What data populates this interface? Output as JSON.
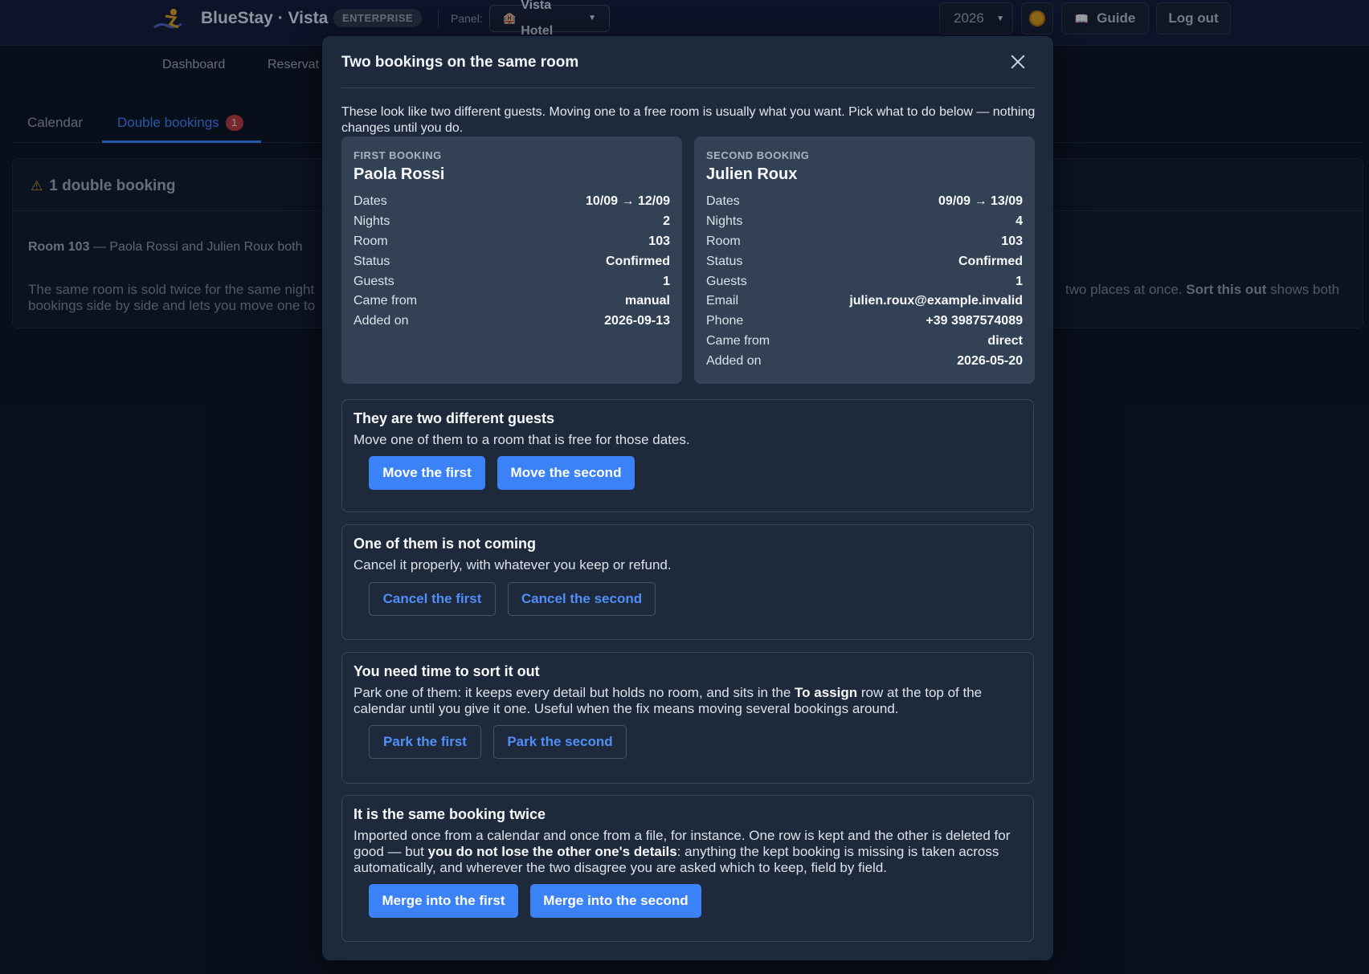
{
  "app": {
    "brand": "BlueStay · Vista",
    "edition": "ENTERPRISE",
    "panel_label": "Panel:",
    "panel_value": "Vista Hotel",
    "year": "2026",
    "guide_label": "Guide",
    "logout_label": "Log out"
  },
  "nav": {
    "items": [
      "Dashboard",
      "Reservat"
    ]
  },
  "subtabs": {
    "calendar": "Calendar",
    "double_bookings": "Double bookings",
    "double_bookings_count": "1"
  },
  "conflict": {
    "header": "1 double booking",
    "room": "Room 103",
    "line": "— Paola Rossi and Julien Roux both",
    "desc_left": "The same room is sold twice for the same night bookings side by side and lets you move one to",
    "desc_right_pre": "two places at once.",
    "desc_right_bold": "Sort this out",
    "desc_right_post": "shows both"
  },
  "modal": {
    "title": "Two bookings on the same room",
    "intro": "These look like two different guests. Moving one to a free room is usually what you want. Pick what to do below — nothing changes until you do.",
    "first": {
      "label": "FIRST BOOKING",
      "name": "Paola Rossi",
      "rows": [
        {
          "k": "Dates",
          "v": "10/09 → 12/09"
        },
        {
          "k": "Nights",
          "v": "2"
        },
        {
          "k": "Room",
          "v": "103"
        },
        {
          "k": "Status",
          "v": "Confirmed"
        },
        {
          "k": "Guests",
          "v": "1"
        },
        {
          "k": "Came from",
          "v": "manual"
        },
        {
          "k": "Added on",
          "v": "2026-09-13"
        }
      ]
    },
    "second": {
      "label": "SECOND BOOKING",
      "name": "Julien Roux",
      "rows": [
        {
          "k": "Dates",
          "v": "09/09 → 13/09"
        },
        {
          "k": "Nights",
          "v": "4"
        },
        {
          "k": "Room",
          "v": "103"
        },
        {
          "k": "Status",
          "v": "Confirmed"
        },
        {
          "k": "Guests",
          "v": "1"
        },
        {
          "k": "Email",
          "v": "julien.roux@example.invalid"
        },
        {
          "k": "Phone",
          "v": "+39 3987574089"
        },
        {
          "k": "Came from",
          "v": "direct"
        },
        {
          "k": "Added on",
          "v": "2026-05-20"
        }
      ]
    },
    "options": {
      "different": {
        "title": "They are two different guests",
        "desc": "Move one of them to a room that is free for those dates.",
        "btn1": "Move the first",
        "btn2": "Move the second"
      },
      "not_coming": {
        "title": "One of them is not coming",
        "desc": "Cancel it properly, with whatever you keep or refund.",
        "btn1": "Cancel the first",
        "btn2": "Cancel the second"
      },
      "need_time": {
        "title": "You need time to sort it out",
        "desc_pre": "Park one of them: it keeps every detail but holds no room, and sits in the",
        "desc_bold": "To assign",
        "desc_post": "row at the top of the calendar until you give it one. Useful when the fix means moving several bookings around.",
        "btn1": "Park the first",
        "btn2": "Park the second"
      },
      "same": {
        "title": "It is the same booking twice",
        "desc_pre": "Imported once from a calendar and once from a file, for instance. One row is kept and the other is deleted for good — but",
        "desc_bold": "you do not lose the other one's details",
        "desc_post": ": anything the kept booking is missing is taken across automatically, and wherever the two disagree you are asked which to keep, field by field.",
        "btn1": "Merge into the first",
        "btn2": "Merge into the second"
      }
    }
  },
  "colors": {
    "accent": "#3b82f6",
    "modal_bg": "#1e293b",
    "card_bg": "#334155",
    "page_bg": "#0b1120",
    "danger_badge": "#b23a3a",
    "warning": "#d19217"
  },
  "icons": [
    "logo-icon",
    "hotel-icon",
    "chevron-down-icon",
    "sun-icon",
    "book-icon",
    "warning-icon",
    "close-icon"
  ]
}
